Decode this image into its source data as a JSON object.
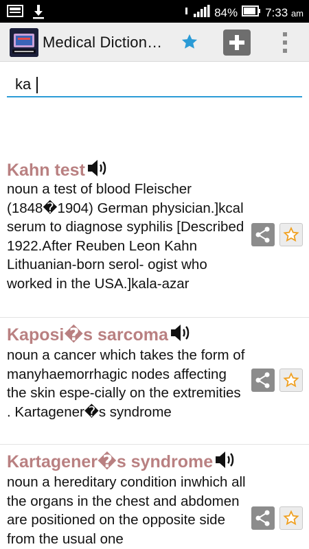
{
  "status_bar": {
    "battery": "84%",
    "time": "7:33",
    "ampm": "am"
  },
  "app_bar": {
    "title": "Medical Diction…",
    "icon_text": "MEDICAL DICTIONARY"
  },
  "search": {
    "value": "ka"
  },
  "entries": [
    {
      "term": "Kahn test",
      "definition": "noun a test of blood Fleischer (1848�1904) German physician.]kcal serum to diagnose syphilis [Described 1922.After Reuben Leon Kahn Lithuanian-born serol- ogist who worked in the USA.]kala-azar"
    },
    {
      "term": "Kaposi�s sarcoma",
      "definition": "noun a cancer which takes the form of manyhaemorrhagic nodes affecting the skin espe-cially on the extremities . Kartagener�s syndrome"
    },
    {
      "term": "Kartagener�s syndrome",
      "definition": "noun a hereditary condition inwhich all the organs in the chest and abdomen are positioned on the opposite side from the usual one"
    }
  ],
  "colors": {
    "term": "#b98081",
    "search_underline": "#2b9bd6",
    "star": "#f0a020"
  }
}
